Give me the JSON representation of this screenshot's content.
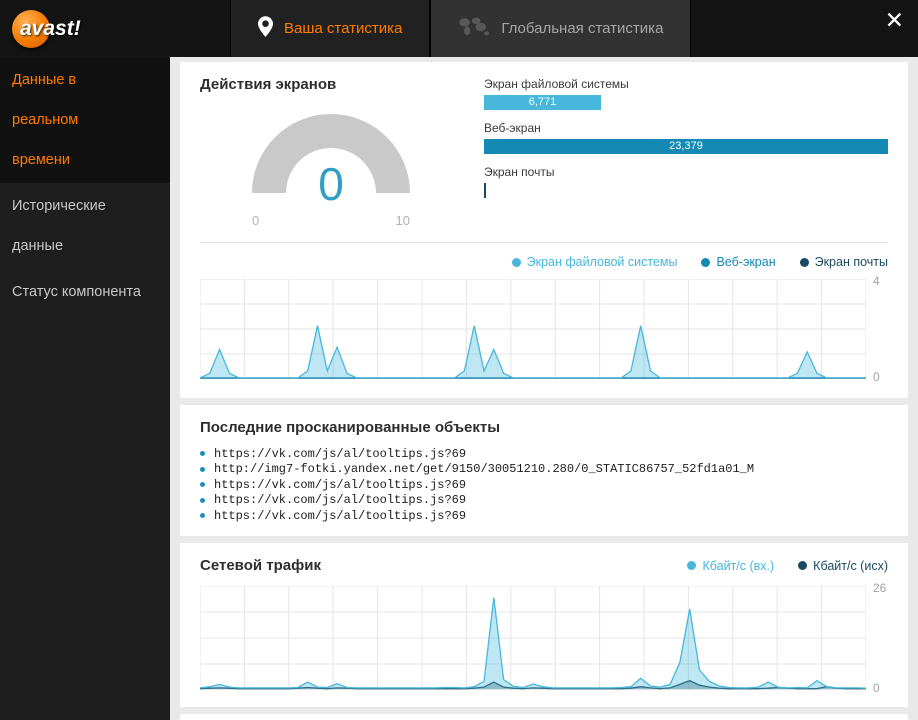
{
  "colors": {
    "accent_orange": "#ff7c00",
    "series_light_blue": "#47b7dc",
    "series_mid_blue": "#1389b4",
    "series_dark_navy": "#1a4a61",
    "gauge_value_blue": "#2f9fc6"
  },
  "topbar": {
    "logo": "avast!",
    "tabs": [
      {
        "label": "Ваша статистика",
        "icon": "location-pin-icon",
        "active": true
      },
      {
        "label": "Глобальная статистика",
        "icon": "globe-icon",
        "active": false
      }
    ],
    "close": "✕"
  },
  "sidebar": {
    "items": [
      {
        "label": "Данные в реальном\nвремени",
        "active": true
      },
      {
        "label": "Исторические\nданные",
        "active": false
      },
      {
        "label": "Статус компонента",
        "active": false
      }
    ]
  },
  "screen_actions": {
    "title": "Действия экранов",
    "gauge": {
      "value": "0",
      "min": "0",
      "max": "10"
    },
    "bars": [
      {
        "label": "Экран файловой системы",
        "value": 6771,
        "display": "6,771",
        "color": "#47b7dc"
      },
      {
        "label": "Веб-экран",
        "value": 23379,
        "display": "23,379",
        "color": "#1389b4"
      },
      {
        "label": "Экран почты",
        "value": 0,
        "display": "",
        "color": "#1a4a61"
      }
    ]
  },
  "scanned_objects": {
    "title": "Последние просканированные объекты",
    "items": [
      "https://vk.com/js/al/tooltips.js?69",
      "http://img7-fotki.yandex.net/get/9150/30051210.280/0_STATIC86757_52fd1a01_M",
      "https://vk.com/js/al/tooltips.js?69",
      "https://vk.com/js/al/tooltips.js?69",
      "https://vk.com/js/al/tooltips.js?69"
    ]
  },
  "network_traffic": {
    "title": "Сетевой трафик"
  },
  "chart_data": [
    {
      "type": "area",
      "title": "Действия экранов",
      "ylim": [
        0,
        4
      ],
      "yticks": {
        "top": "4",
        "bottom": "0"
      },
      "grid": true,
      "legend_position": "top-right",
      "series": [
        {
          "name": "Экран файловой системы",
          "color": "#47b7dc",
          "values": [
            0,
            0.2,
            1.2,
            0.2,
            0,
            0,
            0,
            0,
            0,
            0,
            0,
            0.3,
            2.2,
            0.3,
            1.3,
            0.2,
            0,
            0,
            0,
            0,
            0,
            0,
            0,
            0,
            0,
            0,
            0,
            0.3,
            2.2,
            0.3,
            1.2,
            0.2,
            0,
            0,
            0,
            0,
            0,
            0,
            0,
            0,
            0,
            0,
            0,
            0,
            0.3,
            2.2,
            0.3,
            0,
            0,
            0,
            0,
            0,
            0,
            0,
            0,
            0,
            0,
            0,
            0,
            0,
            0,
            0.2,
            1.1,
            0.2,
            0,
            0,
            0,
            0,
            0
          ]
        },
        {
          "name": "Веб-экран",
          "color": "#1389b4",
          "values": [
            0,
            0
          ]
        },
        {
          "name": "Экран почты",
          "color": "#1a4a61",
          "values": [
            0,
            0
          ]
        }
      ]
    },
    {
      "type": "area",
      "title": "Сетевой трафик",
      "ylim": [
        0,
        26
      ],
      "yticks": {
        "top": "26",
        "bottom": "0"
      },
      "grid": true,
      "legend_position": "top-right",
      "series": [
        {
          "name": "Кбайт/с (вх.)",
          "color": "#47b7dc",
          "values": [
            0.3,
            0.6,
            1.2,
            0.5,
            0.3,
            0.3,
            0.3,
            0.3,
            0.3,
            0.3,
            0.4,
            1.8,
            0.5,
            0.4,
            1.4,
            0.4,
            0.3,
            0.3,
            0.3,
            0.3,
            0.3,
            0.3,
            0.3,
            0.3,
            0.3,
            0.4,
            0.4,
            0.3,
            0.6,
            2,
            24,
            2.5,
            0.7,
            0.4,
            1.3,
            0.6,
            0.3,
            0.3,
            0.3,
            0.3,
            0.3,
            0.3,
            0.3,
            0.4,
            0.6,
            2.8,
            0.8,
            0.5,
            1.2,
            7,
            21,
            5,
            2,
            0.8,
            0.4,
            0.3,
            0.3,
            0.5,
            1.8,
            0.5,
            0.3,
            0.4,
            0.3,
            2.2,
            0.6,
            0.3,
            0.3,
            0.3,
            0.2
          ]
        },
        {
          "name": "Кбайт/с (исх)",
          "color": "#1a4a61",
          "values": [
            0.1,
            0.2,
            0.3,
            0.2,
            0.1,
            0.1,
            0.1,
            0.1,
            0.1,
            0.1,
            0.2,
            0.4,
            0.2,
            0.1,
            0.3,
            0.2,
            0.1,
            0.1,
            0.1,
            0.1,
            0.1,
            0.1,
            0.1,
            0.1,
            0.1,
            0.1,
            0.1,
            0.1,
            0.2,
            0.5,
            1.8,
            0.5,
            0.2,
            0.1,
            0.3,
            0.2,
            0.1,
            0.1,
            0.1,
            0.1,
            0.1,
            0.1,
            0.1,
            0.1,
            0.2,
            0.6,
            0.3,
            0.1,
            0.3,
            1.2,
            2.2,
            1.0,
            0.5,
            0.2,
            0.1,
            0.1,
            0.1,
            0.1,
            0.2,
            0.4,
            0.2,
            0.1,
            0.1,
            0.1,
            0.6,
            0.2,
            0.1,
            0.1,
            0.1
          ]
        }
      ]
    }
  ]
}
